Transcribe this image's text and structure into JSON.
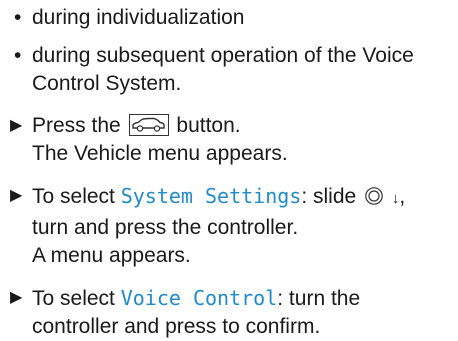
{
  "bullets": [
    {
      "marker": "•",
      "lines": [
        "during individualization"
      ]
    },
    {
      "marker": "•",
      "lines": [
        "during subsequent operation of the Voice",
        "Control System."
      ]
    }
  ],
  "steps": {
    "marker": "▶",
    "step1": {
      "before": "Press the",
      "icon": "vehicle-button-icon",
      "after": "button.",
      "result": "The Vehicle menu appears."
    },
    "step2": {
      "prefix": "To select ",
      "menu": "System Settings",
      "mid": ": slide",
      "icon": "controller-icon",
      "arrow": "↓",
      "after": ",",
      "line2": "turn and press the controller.",
      "result": "A menu appears."
    },
    "step3": {
      "prefix": "To select ",
      "menu": "Voice Control",
      "suffix": ": turn the",
      "line2": "controller and press to confirm."
    }
  },
  "colors": {
    "text": "#1a1a1a",
    "menu_text": "#1f8bc9"
  }
}
